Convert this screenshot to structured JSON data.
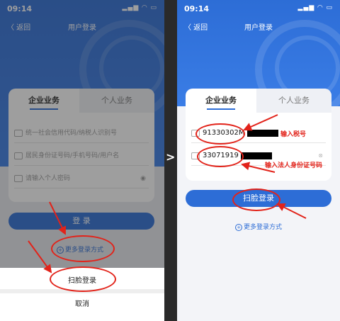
{
  "left": {
    "status_time": "09:14",
    "status_icons": "▂▄▆ ◠ ▭",
    "nav_back": "〈 返回",
    "nav_title": "用户登录",
    "tab_enterprise": "企业业务",
    "tab_personal": "个人业务",
    "placeholder_credit_code": "统一社会信用代码/纳税人识别号",
    "placeholder_id": "居民身份证号码/手机号码/用户名",
    "placeholder_password": "请输入个人密码",
    "login_button": "登 录",
    "more_login": "更多登录方式",
    "sheet_face_login": "扫脸登录",
    "sheet_cancel": "取消"
  },
  "right": {
    "status_time": "09:14",
    "status_icons": "▂▄▆ ◠ ▭",
    "nav_back": "〈 返回",
    "nav_title": "用户登录",
    "tab_enterprise": "企业业务",
    "tab_personal": "个人业务",
    "tax_id_value": "91330302M",
    "id_value": "33071919",
    "annotation_tax": "输入税号",
    "annotation_id": "输入法人身份证号码",
    "face_login_button": "扫脸登录",
    "more_login": "更多登录方式"
  },
  "divider_arrow": ">",
  "colors": {
    "brand_blue": "#2d6dd6",
    "annotation_red": "#e2231a"
  }
}
